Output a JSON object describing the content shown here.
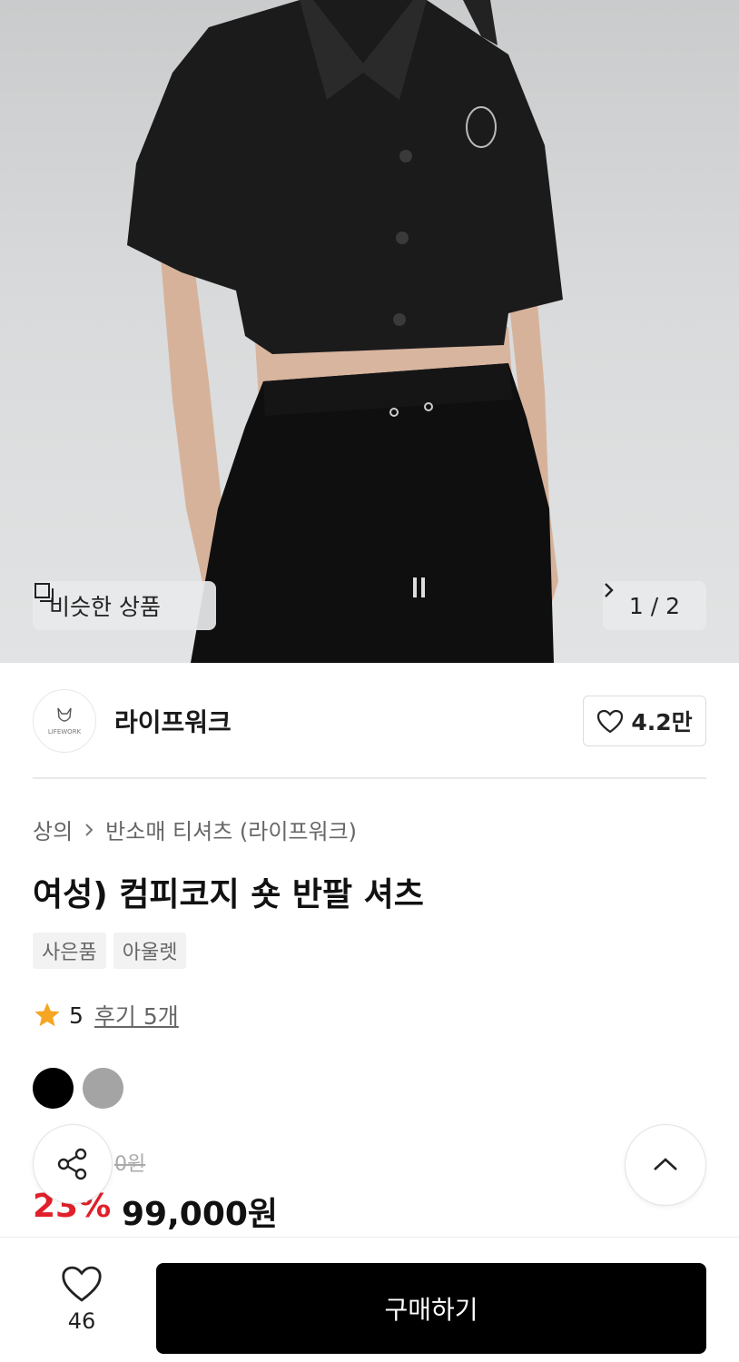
{
  "hero": {
    "similar_label": "비슷한 상품",
    "page_counter": "1 / 2",
    "icons": {
      "similar": "similar-items-icon",
      "next": "chevron-right-icon"
    }
  },
  "brand": {
    "name": "라이프워크",
    "like_count": "4.2만",
    "logo_text": "LIFEWORK"
  },
  "product": {
    "breadcrumb": [
      "상의",
      "반소매 티셔츠 (라이프워크)"
    ],
    "title": "여성) 컴피코지 숏 반팔 셔츠",
    "tags": [
      "사은품",
      "아울렛"
    ],
    "rating": "5",
    "reviews": "후기 5개",
    "colors": [
      "#000000",
      "#a4a4a4"
    ]
  },
  "price": {
    "original": "0원",
    "discount": "23%",
    "final": "99,000원"
  },
  "bottom": {
    "wish_count": "46",
    "buy_label": "구매하기"
  },
  "colors": {
    "accent_red": "#e0202a",
    "star": "#f5a623",
    "buy_button": "#000000"
  }
}
